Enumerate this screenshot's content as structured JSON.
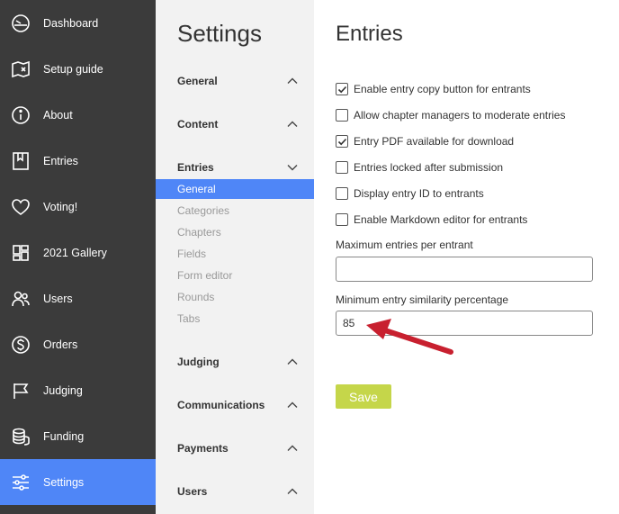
{
  "nav": {
    "items": [
      {
        "label": "Dashboard",
        "icon": "dashboard-gauge-icon"
      },
      {
        "label": "Setup guide",
        "icon": "map-icon"
      },
      {
        "label": "About",
        "icon": "info-icon"
      },
      {
        "label": "Entries",
        "icon": "bookmark-icon"
      },
      {
        "label": "Voting!",
        "icon": "heart-icon"
      },
      {
        "label": "2021 Gallery",
        "icon": "gallery-grid-icon"
      },
      {
        "label": "Users",
        "icon": "users-icon"
      },
      {
        "label": "Orders",
        "icon": "dollar-icon"
      },
      {
        "label": "Judging",
        "icon": "flag-icon"
      },
      {
        "label": "Funding",
        "icon": "coins-icon"
      },
      {
        "label": "Settings",
        "icon": "sliders-icon",
        "active": true
      }
    ]
  },
  "settings": {
    "title": "Settings",
    "sections": [
      {
        "label": "General"
      },
      {
        "label": "Content"
      },
      {
        "label": "Entries",
        "expanded": true
      },
      {
        "label": "Judging"
      },
      {
        "label": "Communications"
      },
      {
        "label": "Payments"
      },
      {
        "label": "Users"
      }
    ],
    "entries_items": [
      "General",
      "Categories",
      "Chapters",
      "Fields",
      "Form editor",
      "Rounds",
      "Tabs"
    ],
    "active_item": "General"
  },
  "main": {
    "title": "Entries",
    "checkboxes": [
      {
        "label": "Enable entry copy button for entrants",
        "checked": true
      },
      {
        "label": "Allow chapter managers to moderate entries",
        "checked": false
      },
      {
        "label": "Entry PDF available for download",
        "checked": true
      },
      {
        "label": "Entries locked after submission",
        "checked": false
      },
      {
        "label": "Display entry ID to entrants",
        "checked": false
      },
      {
        "label": "Enable Markdown editor for entrants",
        "checked": false
      }
    ],
    "max_entries": {
      "label": "Maximum entries per entrant",
      "value": ""
    },
    "min_similarity": {
      "label": "Minimum entry similarity percentage",
      "value": "85"
    },
    "save_label": "Save"
  },
  "colors": {
    "nav_bg": "#3b3b3b",
    "accent": "#4f86f7",
    "settings_bg": "#f2f2f2",
    "save_bg": "#c5d64a",
    "annotation_arrow": "#c8202f"
  }
}
